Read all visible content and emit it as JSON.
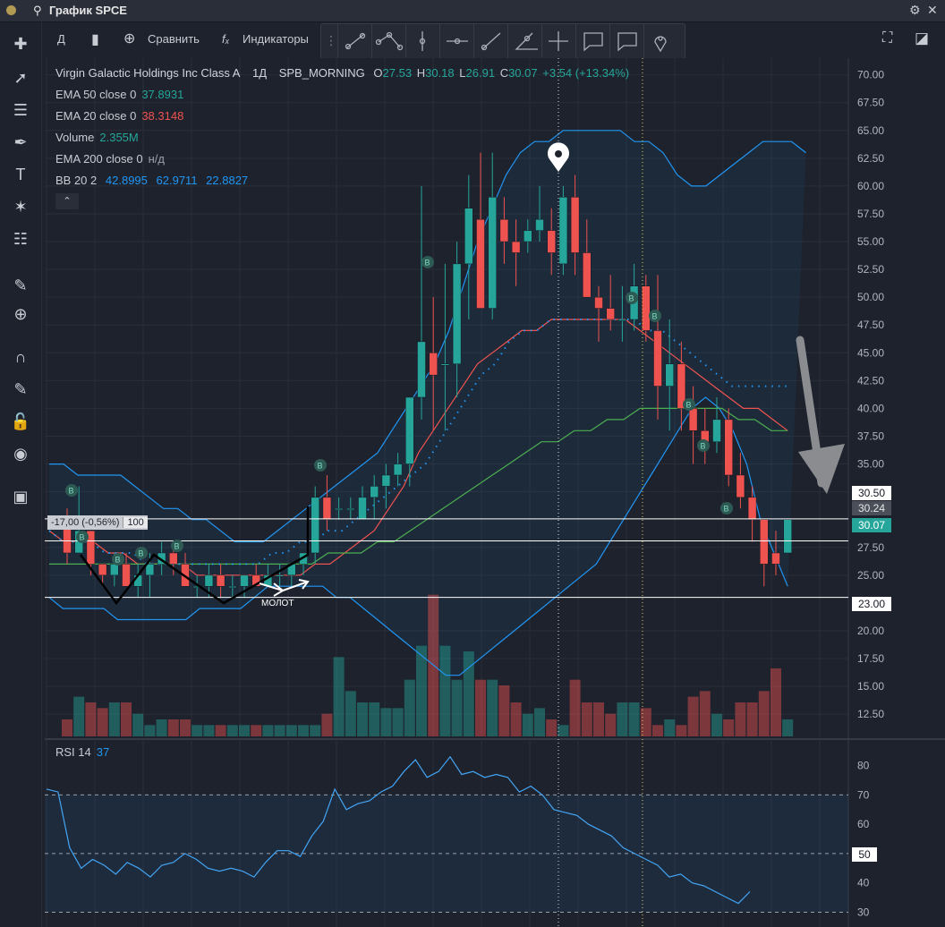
{
  "window": {
    "title": "График SPCE"
  },
  "toolbar": {
    "interval": "Д",
    "compare": "Сравнить",
    "indicators": "Индикаторы"
  },
  "legend": {
    "symbol_name": "Virgin Galactic Holdings Inc Class A",
    "interval": "1Д",
    "exchange": "SPB_MORNING",
    "open_label": "O",
    "open": "27.53",
    "high_label": "H",
    "high": "30.18",
    "low_label": "L",
    "low": "26.91",
    "close_label": "C",
    "close": "30.07",
    "change": "+3.54 (+13.34%)",
    "ema50_label": "EMA 50 close 0",
    "ema50_value": "37.8931",
    "ema20_label": "EMA 20 close 0",
    "ema20_value": "38.3148",
    "volume_label": "Volume",
    "volume_value": "2.355M",
    "ema200_label": "EMA 200 close 0",
    "ema200_value": "н/д",
    "bb_label": "BB 20 2",
    "bb_basis": "42.8995",
    "bb_upper": "62.9711",
    "bb_lower": "22.8827"
  },
  "measure": {
    "delta": "-17,00 (-0,56%)",
    "bars": "100"
  },
  "annotation": {
    "hammer": "МОЛОТ",
    "signal_marker": "B"
  },
  "rsi": {
    "label": "RSI 14",
    "value": "37",
    "ticks": [
      "80",
      "70",
      "60",
      "50",
      "40",
      "30"
    ],
    "level_tag": "50"
  },
  "price_axis": {
    "ticks": [
      "70.00",
      "67.50",
      "65.00",
      "62.50",
      "60.00",
      "57.50",
      "55.00",
      "52.50",
      "50.00",
      "47.50",
      "45.00",
      "42.50",
      "40.00",
      "37.50",
      "35.00",
      "32.50",
      "27.50",
      "25.00",
      "20.00",
      "17.50",
      "15.00",
      "12.50"
    ],
    "tags": {
      "level_high": "30.50",
      "last_grey": "30.24",
      "last_green": "30.07",
      "level_low": "23.00"
    }
  },
  "colors": {
    "up": "#26a69a",
    "down": "#ef5350",
    "bb": "#2196f3",
    "ema20": "#ef5350",
    "ema50": "#4caf50",
    "bg": "#1e222d"
  },
  "chart_data": {
    "type": "candlestick",
    "ylim": [
      10.5,
      71.5
    ],
    "candles": [
      [
        30,
        31,
        26,
        27
      ],
      [
        27,
        33,
        27,
        29
      ],
      [
        29,
        29,
        25,
        26
      ],
      [
        26,
        26,
        24,
        25
      ],
      [
        25,
        27,
        24,
        26
      ],
      [
        26,
        27,
        24,
        24
      ],
      [
        24,
        26,
        23,
        25
      ],
      [
        25,
        27,
        23,
        26
      ],
      [
        26,
        28,
        25,
        27
      ],
      [
        27,
        28,
        25,
        26
      ],
      [
        26,
        27,
        24,
        24
      ],
      [
        24,
        25,
        23,
        24
      ],
      [
        24,
        26,
        23,
        25
      ],
      [
        25,
        26,
        23,
        24
      ],
      [
        24,
        25,
        23,
        24
      ],
      [
        24,
        25,
        23,
        25
      ],
      [
        25,
        26,
        24,
        24
      ],
      [
        24,
        26,
        24,
        25
      ],
      [
        25,
        26,
        24,
        25
      ],
      [
        25,
        26,
        24,
        26
      ],
      [
        26,
        27,
        25,
        27
      ],
      [
        27,
        33,
        26,
        32
      ],
      [
        32,
        34,
        29,
        30
      ],
      [
        31,
        32,
        30,
        31
      ],
      [
        31,
        32,
        30,
        31
      ],
      [
        30,
        33,
        30,
        32
      ],
      [
        32,
        34,
        30,
        33
      ],
      [
        33,
        35,
        31,
        34
      ],
      [
        34,
        36,
        33,
        35
      ],
      [
        35,
        41,
        33,
        41
      ],
      [
        41,
        60,
        39,
        46
      ],
      [
        45,
        50,
        38,
        43
      ],
      [
        44,
        53,
        38,
        44
      ],
      [
        44,
        55,
        41,
        53
      ],
      [
        53,
        61,
        48,
        58
      ],
      [
        57,
        63,
        50,
        49
      ],
      [
        49,
        63,
        48,
        59
      ],
      [
        57,
        59,
        53,
        55
      ],
      [
        55,
        57,
        51,
        54
      ],
      [
        55,
        57,
        54,
        56
      ],
      [
        56,
        60,
        55,
        57
      ],
      [
        56,
        58,
        52,
        54
      ],
      [
        53,
        60,
        52,
        59
      ],
      [
        59,
        61,
        52,
        54
      ],
      [
        54,
        57,
        50,
        50
      ],
      [
        50,
        51,
        46,
        49
      ],
      [
        49,
        52,
        47,
        48
      ],
      [
        48,
        51,
        46,
        48
      ],
      [
        48,
        53,
        47,
        51
      ],
      [
        51,
        52,
        46,
        47
      ],
      [
        47,
        52,
        39,
        42
      ],
      [
        42,
        48,
        38,
        44
      ],
      [
        44,
        46,
        38,
        40
      ],
      [
        40,
        42,
        35,
        38
      ],
      [
        38,
        40,
        35,
        37
      ],
      [
        37,
        41,
        36,
        39
      ],
      [
        39,
        40,
        33,
        34
      ],
      [
        34,
        36,
        31,
        32
      ],
      [
        32,
        33,
        28,
        30
      ],
      [
        30,
        30,
        24,
        26
      ],
      [
        27,
        29,
        25,
        26
      ],
      [
        27,
        30,
        27,
        30
      ]
    ],
    "volume": [
      3,
      7,
      6,
      5,
      6,
      6,
      4,
      2,
      3,
      3,
      3,
      2,
      2,
      2,
      2,
      2,
      2,
      2,
      2,
      2,
      2,
      2,
      4,
      14,
      8,
      6,
      6,
      5,
      5,
      10,
      16,
      25,
      16,
      10,
      15,
      10,
      10,
      9,
      6,
      4,
      5,
      3,
      2,
      10,
      6,
      6,
      4,
      6,
      6,
      5,
      2,
      3,
      2,
      7,
      8,
      4,
      3,
      6,
      6,
      8,
      12,
      3
    ],
    "rsi": [
      72,
      71,
      52,
      45,
      48,
      46,
      43,
      47,
      45,
      42,
      46,
      47,
      50,
      48,
      45,
      44,
      45,
      44,
      42,
      47,
      51,
      51,
      49,
      56,
      61,
      72,
      65,
      67,
      68,
      71,
      73,
      78,
      82,
      76,
      78,
      83,
      77,
      78,
      76,
      77,
      76,
      71,
      73,
      70,
      65,
      64,
      63,
      60,
      58,
      56,
      52,
      50,
      48,
      46,
      42,
      43,
      40,
      39,
      37,
      35,
      33,
      37
    ],
    "rsi_ylim": [
      28,
      86
    ],
    "bb_upper": [
      35,
      35,
      34,
      34,
      34,
      34,
      33,
      32,
      31,
      31,
      30,
      30,
      29,
      28,
      28,
      28,
      29,
      30,
      31,
      32,
      33,
      34,
      35,
      36,
      38,
      40,
      42,
      44,
      47,
      51,
      55,
      58,
      61,
      63,
      64,
      64,
      65,
      65,
      65,
      65,
      65,
      64,
      64,
      63,
      61,
      60,
      60,
      61,
      62,
      63,
      64,
      64,
      64,
      63
    ],
    "bb_basis": [
      29,
      28,
      28,
      28,
      27,
      27,
      27,
      26,
      26,
      26,
      26,
      26,
      26,
      26,
      26,
      26,
      27,
      27,
      28,
      28,
      29,
      29,
      30,
      31,
      32,
      33,
      34,
      35,
      37,
      39,
      41,
      43,
      44,
      46,
      47,
      47,
      48,
      48,
      48,
      48,
      48,
      48,
      48,
      47,
      47,
      46,
      45,
      44,
      43,
      42,
      42,
      42,
      42,
      42
    ],
    "bb_lower": [
      23,
      22,
      22,
      22,
      22,
      21,
      21,
      21,
      21,
      21,
      21,
      22,
      22,
      22,
      22,
      23,
      24,
      24,
      24,
      24,
      24,
      23,
      23,
      22,
      21,
      20,
      19,
      18,
      17,
      16,
      16,
      17,
      18,
      19,
      20,
      21,
      22,
      23,
      24,
      25,
      26,
      28,
      30,
      32,
      34,
      36,
      38,
      40,
      41,
      40,
      38,
      35,
      30,
      27,
      24
    ],
    "ema20": [
      29,
      28,
      28,
      28,
      27,
      27,
      26,
      26,
      26,
      26,
      25,
      25,
      25,
      25,
      25,
      25,
      25,
      25,
      26,
      26,
      27,
      28,
      29,
      31,
      33,
      36,
      38,
      40,
      42,
      44,
      45,
      46,
      47,
      47,
      48,
      48,
      48,
      48,
      48,
      48,
      47,
      46,
      45,
      44,
      43,
      42,
      41,
      40,
      40,
      39,
      38
    ],
    "ema50": [
      26,
      26,
      26,
      26,
      26,
      26,
      26,
      26,
      26,
      26,
      26,
      26,
      26,
      26,
      26,
      26,
      26,
      27,
      27,
      27,
      28,
      28,
      29,
      30,
      31,
      32,
      33,
      34,
      35,
      36,
      37,
      37,
      38,
      38,
      39,
      39,
      40,
      40,
      40,
      40,
      40,
      40,
      39,
      39,
      38,
      38
    ]
  }
}
